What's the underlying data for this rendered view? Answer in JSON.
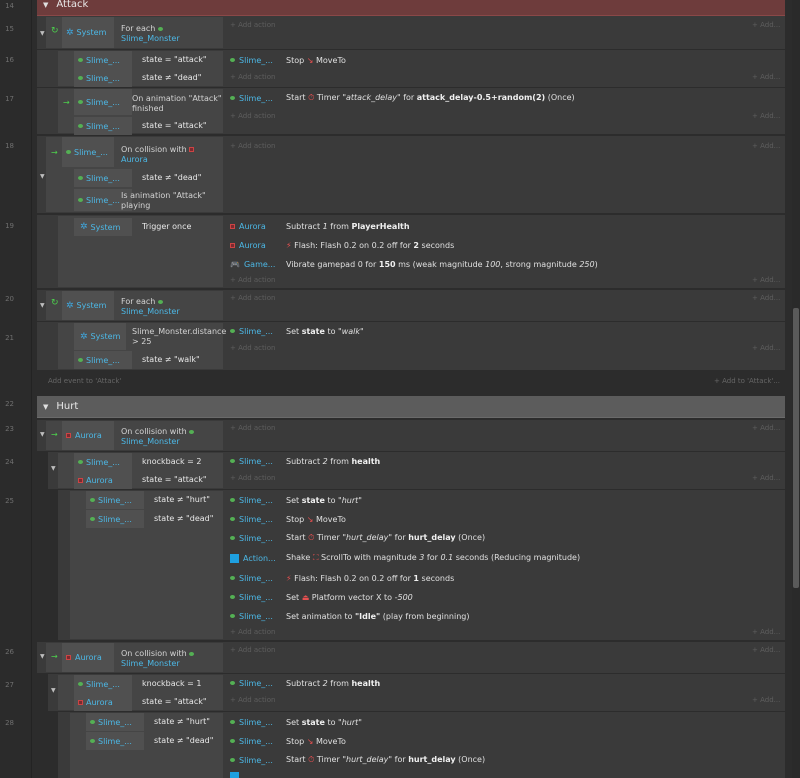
{
  "groups": {
    "attack": {
      "title": "Attack",
      "add_event": "Add event to 'Attack'",
      "add_to": "+ Add to 'Attack'..."
    },
    "hurt": {
      "title": "Hurt"
    }
  },
  "add_action": "+ Add action",
  "add_more": "+ Add...",
  "line_numbers": [
    "14",
    "15",
    "16",
    "17",
    "18",
    "19",
    "20",
    "21",
    "22",
    "23",
    "24",
    "25",
    "26",
    "27",
    "28"
  ],
  "labels": {
    "system": "System",
    "for_each": "For each",
    "slime_monster": "Slime_Monster",
    "slime_short": "Slime_...",
    "aurora": "Aurora",
    "game_short": "Game...",
    "action_short": "Action...",
    "state_attack": "state = \"attack\"",
    "state_not_dead": "state ≠ \"dead\"",
    "state_not_hurt": "state ≠ \"hurt\"",
    "state_not_walk": "state ≠ \"walk\"",
    "on_anim_attack": "On animation \"Attack\"",
    "finished": "finished",
    "on_collision_with": "On collision with",
    "is_anim_attack": "Is animation \"Attack\"",
    "playing": "playing",
    "trigger_once": "Trigger once",
    "distance": "Slime_Monster.distance",
    "gt25": "> 25",
    "knockback2": "knockback = 2",
    "knockback1": "knockback = 1"
  },
  "actions": {
    "stop_moveto": "Stop",
    "moveto": "MoveTo",
    "start": "Start",
    "timer": "Timer",
    "attack_delay_tag": "\"attack_delay\"",
    "for": "for",
    "attack_expr": "attack_delay-0.5+random(2)",
    "once": "(Once)",
    "subtract1": "Subtract",
    "one": "1",
    "from": "from",
    "player_health": "PlayerHealth",
    "flash": "Flash: Flash 0.2 on 0.2 off for",
    "two_seconds": "2",
    "one_second": "1",
    "seconds": "seconds",
    "vibrate": "Vibrate gamepad 0 for",
    "ms150": "150",
    "vibrate_rest": "ms (weak magnitude",
    "weak": "100",
    "strong_lbl": ", strong magnitude",
    "strong": "250",
    "set": "Set",
    "state": "state",
    "to": "to",
    "walk": "\"walk\"",
    "hurt": "\"hurt\"",
    "subtract2": "Subtract",
    "two": "2",
    "health": "health",
    "hurt_delay_tag": "\"hurt_delay\"",
    "hurt_delay": "hurt_delay",
    "shake": "Shake",
    "scrollto": "ScrollTo with magnitude",
    "mag3": "3",
    "for2": "for",
    "t01": "0.1",
    "reducing": "seconds (Reducing magnitude)",
    "platform": "Platform vector X to",
    "minus500": "-500",
    "set_anim": "Set animation to",
    "idle": "\"Idle\"",
    "play_begin": "(play from beginning)"
  }
}
